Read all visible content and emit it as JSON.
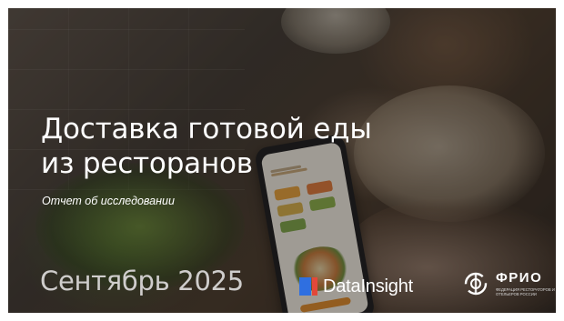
{
  "slide": {
    "title_line1": "Доставка готовой еды",
    "title_line2": "из ресторанов",
    "subtitle": "Отчет об исследовании",
    "date": "Сентябрь 2025"
  },
  "logos": {
    "datainsight": {
      "name": "DataInsight",
      "icon": "datainsight-logo-mark",
      "colors": [
        "#2f6fe0",
        "#e2483a"
      ]
    },
    "frio": {
      "name": "ФРИО",
      "tagline": "Федерация рестораторов и отельеров России",
      "icon": "frio-emblem-icon"
    }
  },
  "colors": {
    "text": "#ffffff",
    "date_text": "#cfcdcc"
  }
}
